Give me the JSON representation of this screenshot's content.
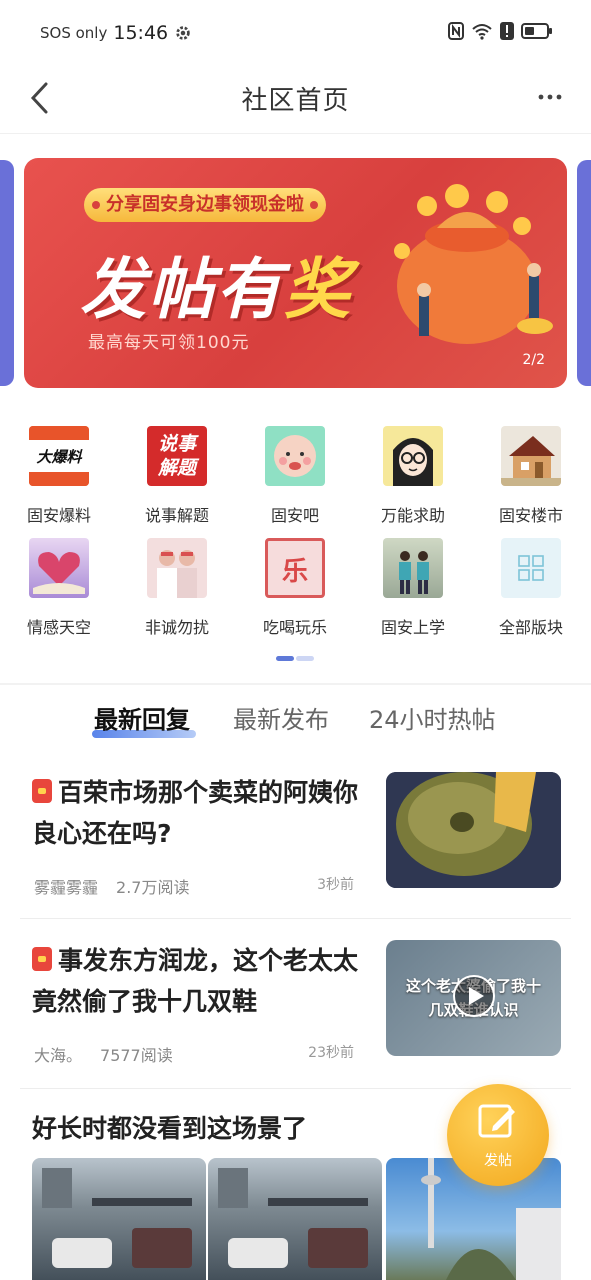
{
  "status_bar": {
    "carrier": "SOS only",
    "time": "15:46",
    "icons": [
      "gear-icon",
      "nfc-icon",
      "wifi-icon",
      "alert-icon",
      "battery-icon"
    ]
  },
  "header": {
    "title": "社区首页",
    "back_icon": "chevron-left-icon",
    "more_icon": "more-dots-icon"
  },
  "banner": {
    "pill": "分享固安身边事领现金啦",
    "headline_white": "发帖有",
    "headline_yellow": "奖",
    "subtitle": "最高每天可领100元",
    "counter": "2/2",
    "current_page": 2,
    "total_pages": 2
  },
  "categories": [
    {
      "label": "固安爆料",
      "thumb_text": "大爆料",
      "icon": "news-icon"
    },
    {
      "label": "说事解题",
      "thumb_text": "说事解题",
      "icon": "talk-icon"
    },
    {
      "label": "固安吧",
      "thumb_text": "",
      "icon": "cartoon-face-icon"
    },
    {
      "label": "万能求助",
      "thumb_text": "",
      "icon": "girl-glasses-icon"
    },
    {
      "label": "固安楼市",
      "thumb_text": "",
      "icon": "house-icon"
    },
    {
      "label": "情感天空",
      "thumb_text": "",
      "icon": "heart-book-icon"
    },
    {
      "label": "非诚勿扰",
      "thumb_text": "",
      "icon": "couple-icon"
    },
    {
      "label": "吃喝玩乐",
      "thumb_text": "乐",
      "icon": "le-pattern-icon"
    },
    {
      "label": "固安上学",
      "thumb_text": "",
      "icon": "students-icon"
    },
    {
      "label": "全部版块",
      "thumb_text": "",
      "icon": "grid-icon"
    }
  ],
  "tabs": [
    {
      "label": "最新回复",
      "active": true
    },
    {
      "label": "最新发布",
      "active": false
    },
    {
      "label": "24小时热帖",
      "active": false
    }
  ],
  "posts": [
    {
      "title": "百荣市场那个卖菜的阿姨你良心还在吗?",
      "author": "雾霾雾霾",
      "views": "2.7万阅读",
      "time": "3秒前",
      "has_redpack": true,
      "thumb": "pumpkin-photo",
      "thumb_text": ""
    },
    {
      "title": "事发东方润龙，这个老太太竟然偷了我十几双鞋",
      "author": "大海。",
      "views": "7577阅读",
      "time": "23秒前",
      "has_redpack": true,
      "thumb": "video-thumbnail",
      "thumb_text": "这个老太婆偷了我十几双鞋谁认识"
    },
    {
      "title": "好长时都没看到这场景了",
      "author": "",
      "views": "",
      "time": "",
      "has_redpack": false,
      "thumb": "",
      "thumb_text": ""
    }
  ],
  "fab": {
    "label": "发帖",
    "icon": "edit-icon"
  },
  "colors": {
    "brand_blue": "#5e79d8",
    "banner_red": "#d8403e",
    "fab_orange": "#f2a71c",
    "redpack": "#e8463c"
  }
}
